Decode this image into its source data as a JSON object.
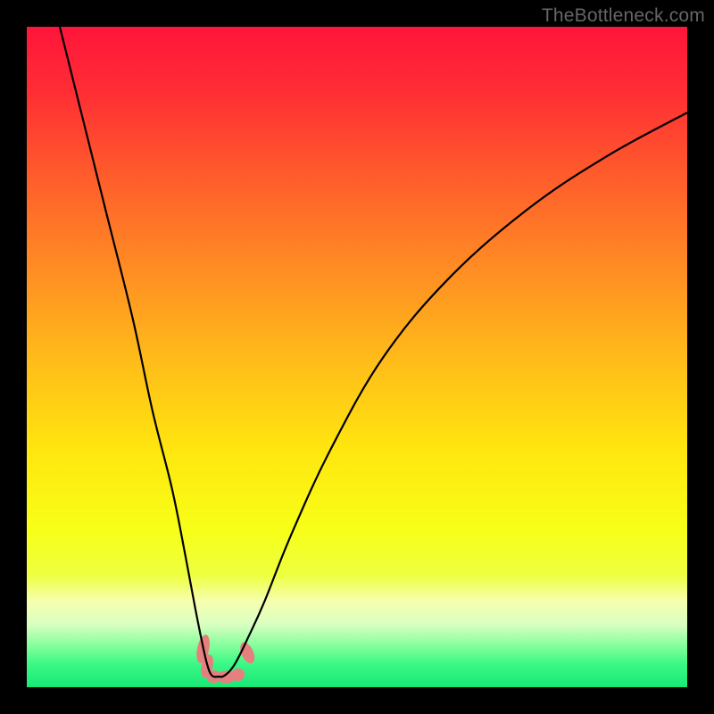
{
  "watermark": "TheBottleneck.com",
  "gradient": {
    "stops": [
      {
        "offset": 0.0,
        "color": "#ff153b"
      },
      {
        "offset": 0.1,
        "color": "#ff2e34"
      },
      {
        "offset": 0.22,
        "color": "#ff5a2c"
      },
      {
        "offset": 0.36,
        "color": "#ff8a24"
      },
      {
        "offset": 0.5,
        "color": "#ffba1a"
      },
      {
        "offset": 0.64,
        "color": "#ffe60f"
      },
      {
        "offset": 0.76,
        "color": "#f7ff17"
      },
      {
        "offset": 0.83,
        "color": "#eeff40"
      },
      {
        "offset": 0.87,
        "color": "#f6ffb0"
      },
      {
        "offset": 0.905,
        "color": "#d9ffc1"
      },
      {
        "offset": 0.935,
        "color": "#89ff9e"
      },
      {
        "offset": 0.965,
        "color": "#3bf885"
      },
      {
        "offset": 1.0,
        "color": "#18e877"
      }
    ]
  },
  "chart_data": {
    "type": "line",
    "title": "",
    "xlabel": "",
    "ylabel": "",
    "xlim": [
      0,
      100
    ],
    "ylim": [
      0,
      100
    ],
    "series": [
      {
        "name": "curve-asymmetric-v",
        "x": [
          5,
          8,
          12,
          16,
          19,
          22,
          24,
          25.5,
          26.5,
          27.3,
          28.0,
          29.0,
          30.0,
          31.5,
          33.5,
          36,
          40,
          46,
          54,
          64,
          76,
          88,
          100
        ],
        "y": [
          100,
          88,
          72,
          56,
          42,
          30,
          20,
          12,
          7,
          3.5,
          1.8,
          1.6,
          1.8,
          3.5,
          7.5,
          13,
          23,
          36,
          50,
          62,
          72.5,
          80.5,
          87
        ]
      }
    ],
    "markers": [
      {
        "name": "pink-pill-low-left",
        "cx": 26.7,
        "cy": 5.8,
        "rx": 0.9,
        "ry": 2.2,
        "rot": 12
      },
      {
        "name": "pink-pill-low-left2",
        "cx": 27.3,
        "cy": 3.2,
        "rx": 0.85,
        "ry": 1.8,
        "rot": 14
      },
      {
        "name": "pink-blob-bottom-1",
        "cx": 28.3,
        "cy": 1.6,
        "rx": 1.1,
        "ry": 0.95,
        "rot": 0
      },
      {
        "name": "pink-blob-bottom-2",
        "cx": 30.2,
        "cy": 1.55,
        "rx": 1.5,
        "ry": 0.95,
        "rot": 0
      },
      {
        "name": "pink-blob-bottom-3",
        "cx": 32.0,
        "cy": 1.9,
        "rx": 1.0,
        "ry": 0.95,
        "rot": -15
      },
      {
        "name": "pink-pill-low-right",
        "cx": 33.4,
        "cy": 5.2,
        "rx": 0.9,
        "ry": 1.7,
        "rot": -25
      }
    ],
    "marker_fill": "#e6807f"
  }
}
